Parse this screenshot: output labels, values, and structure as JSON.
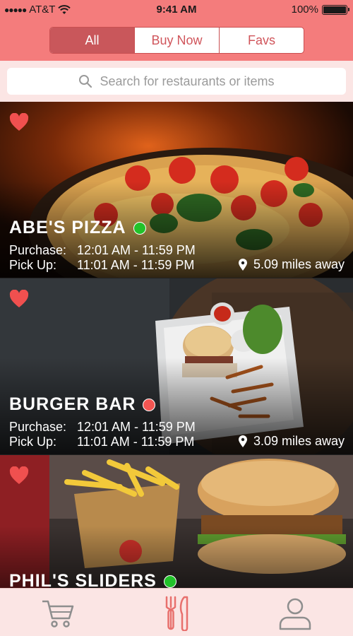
{
  "status_bar": {
    "carrier": "AT&T",
    "time": "9:41 AM",
    "battery": "100%"
  },
  "segments": {
    "items": [
      "All",
      "Buy Now",
      "Favs"
    ],
    "active": "All"
  },
  "search": {
    "placeholder": "Search for restaurants or items"
  },
  "restaurants": [
    {
      "name": "ABE'S PIZZA",
      "status_color": "#22c22a",
      "purchase_label": "Purchase:",
      "purchase_time": "12:01 AM - 11:59 PM",
      "pickup_label": "Pick Up:",
      "pickup_time": "11:01 AM - 11:59 PM",
      "distance": "5.09 miles away",
      "favorited": true
    },
    {
      "name": "BURGER BAR",
      "status_color": "#f25552",
      "purchase_label": "Purchase:",
      "purchase_time": "12:01 AM - 11:59 PM",
      "pickup_label": "Pick Up:",
      "pickup_time": "11:01 AM - 11:59 PM",
      "distance": "3.09 miles away",
      "favorited": true
    },
    {
      "name": "PHIL'S SLIDERS",
      "status_color": "#22c22a",
      "favorited": true
    }
  ],
  "tab_bar": {
    "items": [
      "cart-icon",
      "fork-knife-icon",
      "user-icon"
    ],
    "active": "fork-knife-icon"
  },
  "colors": {
    "brand": "#f47c7c",
    "brand_dark": "#c9575b",
    "light_pink": "#fbe5e4",
    "heart": "#f0504f"
  }
}
